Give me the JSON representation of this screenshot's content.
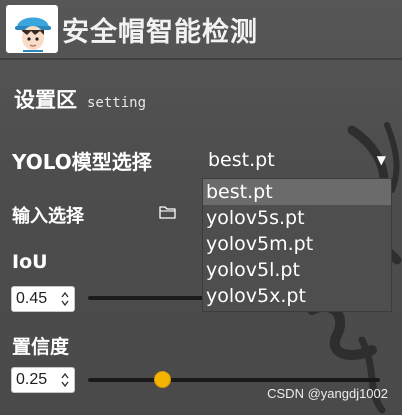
{
  "app": {
    "title": "安全帽智能检测"
  },
  "settings": {
    "title": "设置区",
    "subtitle": "setting"
  },
  "model": {
    "label": "YOLO模型选择",
    "selected": "best.pt",
    "options": [
      "best.pt",
      "yolov5s.pt",
      "yolov5m.pt",
      "yolov5l.pt",
      "yolov5x.pt"
    ]
  },
  "input": {
    "label": "输入选择"
  },
  "iou": {
    "label": "IoU",
    "value": "0.45"
  },
  "confidence": {
    "label": "置信度",
    "value": "0.25",
    "slider_fraction": 0.25
  },
  "watermark": "CSDN @yangdj1002",
  "colors": {
    "accent": "#f4b400",
    "background": "#4b4b4b",
    "text": "#ffffff"
  }
}
